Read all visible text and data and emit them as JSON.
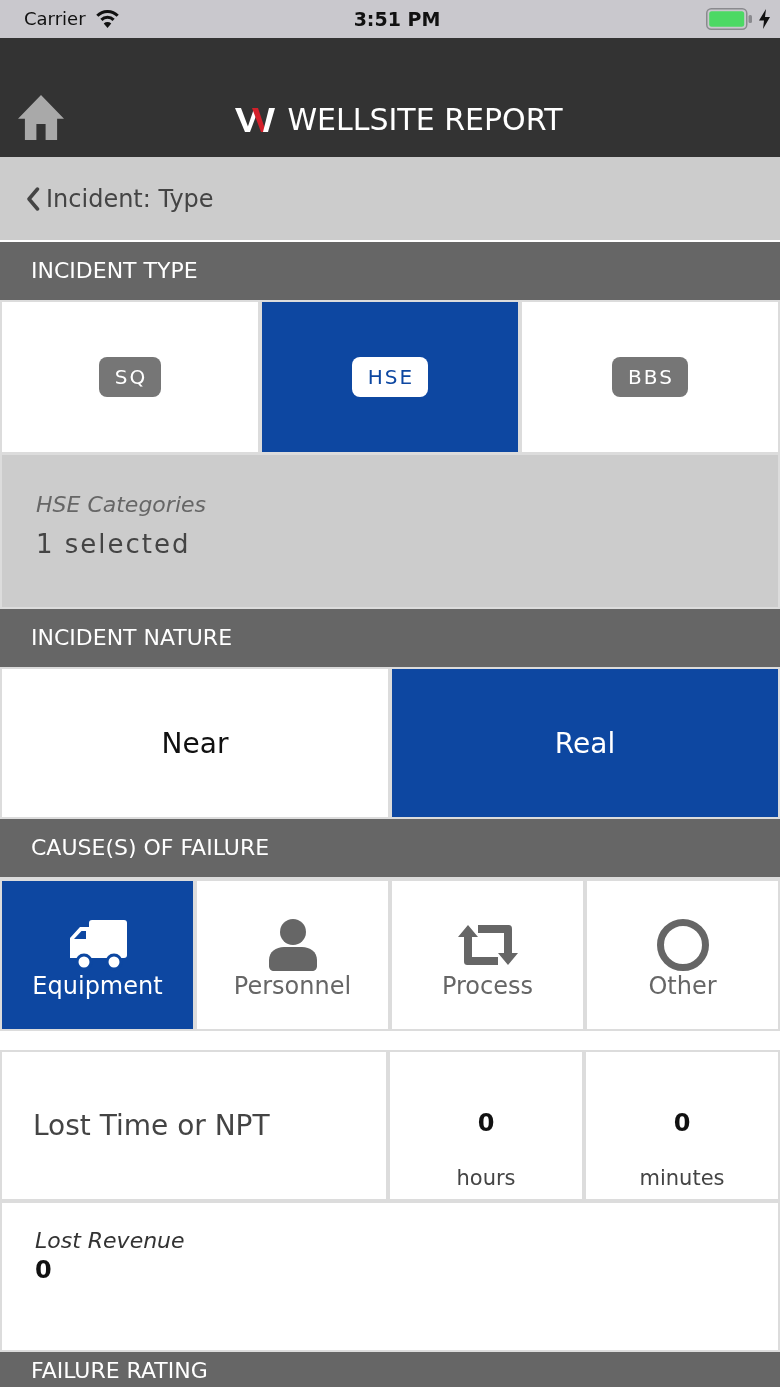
{
  "status_bar": {
    "carrier": "Carrier",
    "time": "3:51 PM"
  },
  "nav_bar": {
    "title": "WELLSITE REPORT"
  },
  "back_bar": {
    "label": "Incident: Type"
  },
  "incident_type": {
    "title": "INCIDENT TYPE",
    "options": [
      {
        "label": "SQ",
        "selected": false
      },
      {
        "label": "HSE",
        "selected": true
      },
      {
        "label": "BBS",
        "selected": false
      }
    ],
    "categories": {
      "label": "HSE Categories",
      "value": "1 selected"
    }
  },
  "incident_nature": {
    "title": "INCIDENT NATURE",
    "options": [
      {
        "label": "Near",
        "selected": false
      },
      {
        "label": "Real",
        "selected": true
      }
    ]
  },
  "causes_of_failure": {
    "title": "CAUSE(S) OF FAILURE",
    "options": [
      {
        "label": "Equipment",
        "selected": true
      },
      {
        "label": "Personnel",
        "selected": false
      },
      {
        "label": "Process",
        "selected": false
      },
      {
        "label": "Other",
        "selected": false
      }
    ]
  },
  "lost_time": {
    "label": "Lost Time or NPT",
    "fields": [
      {
        "value": "0",
        "unit": "hours"
      },
      {
        "value": "0",
        "unit": "minutes"
      }
    ]
  },
  "lost_revenue": {
    "label": "Lost Revenue",
    "value": "0"
  },
  "failure_rating": {
    "title": "FAILURE RATING"
  }
}
